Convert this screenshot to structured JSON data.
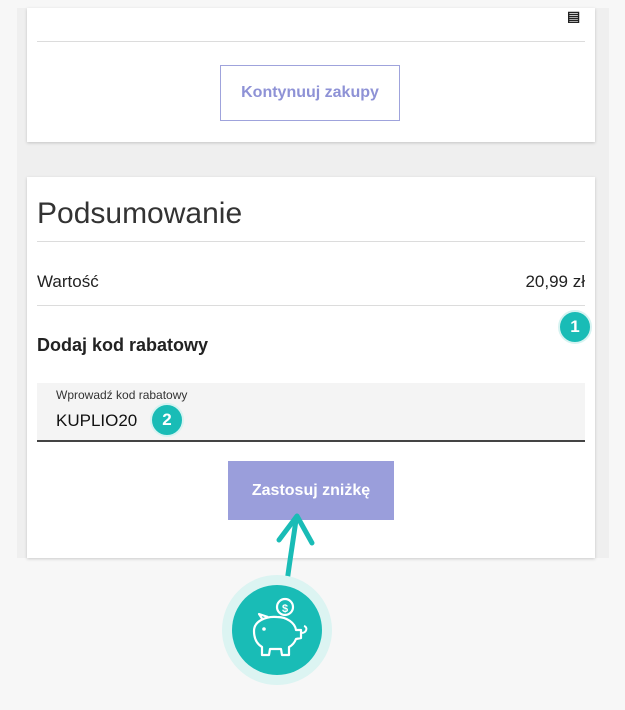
{
  "cart": {
    "menu_icon": "barcode-icon",
    "continue_button": "Kontynuuj zakupy"
  },
  "summary": {
    "title": "Podsumowanie",
    "value_label": "Wartość",
    "value_amount": "20,99 zł",
    "discount_title": "Dodaj kod rabatowy",
    "caret_icon": "chevron-up-icon",
    "input_label": "Wprowadź kod rabatowy",
    "input_value": "KUPLIO20",
    "apply_button": "Zastosuj zniżkę"
  },
  "annotations": {
    "badge_1": "1",
    "badge_2": "2"
  },
  "colors": {
    "accent": "#9a9edb",
    "teal": "#19bcb6"
  },
  "icons": {
    "piggy_bank": "piggy-bank-icon",
    "arrow": "arrow-up-icon"
  }
}
